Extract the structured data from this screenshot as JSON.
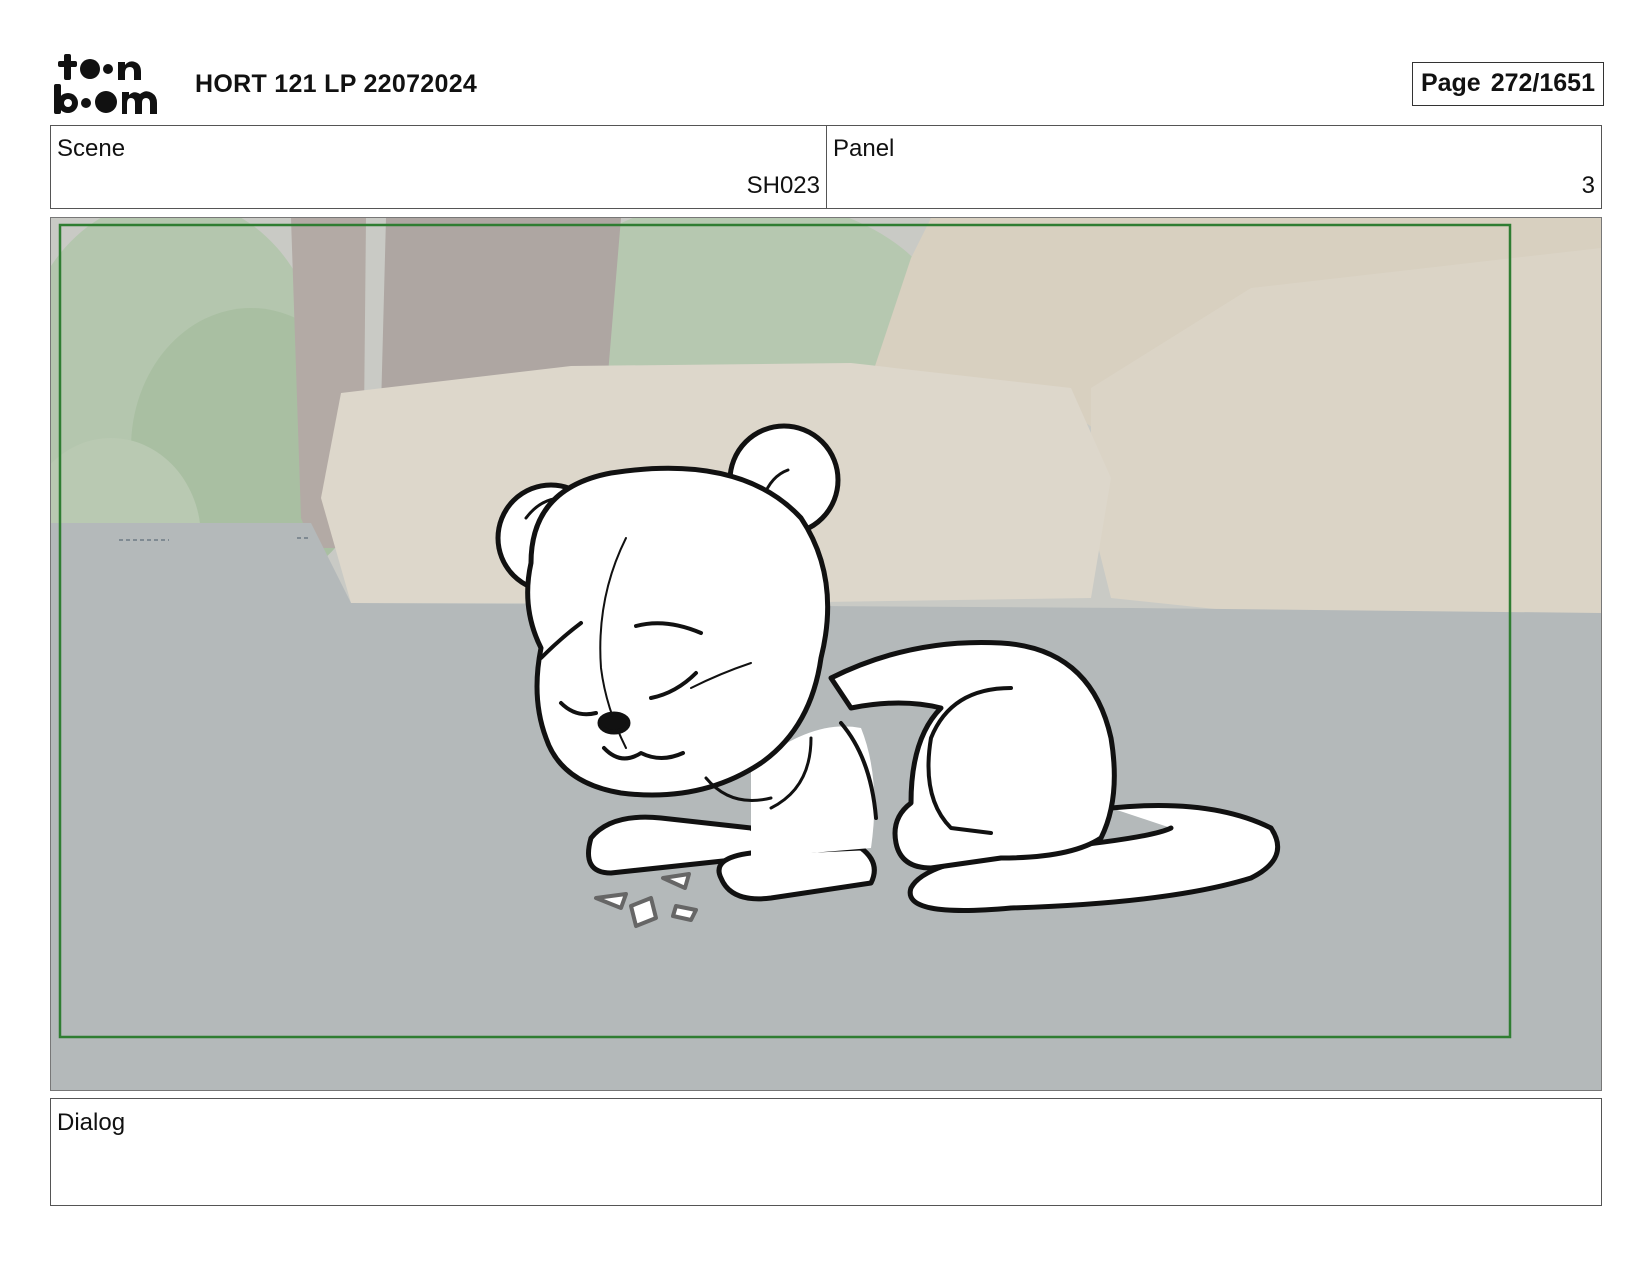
{
  "header": {
    "logo_text": "toon boom",
    "title": "HORT 121 LP 22072024",
    "page_label": "Page",
    "page_value": "272/1651"
  },
  "scene": {
    "label": "Scene",
    "value": "SH023"
  },
  "panel": {
    "label": "Panel",
    "value": "3"
  },
  "dialog": {
    "label": "Dialog",
    "value": ""
  },
  "colors": {
    "frame_border": "#2f7d32",
    "ground": "#b4b9ba",
    "rock": "#d8d0c0",
    "foliage": "#a9bfa2",
    "trunk": "#aaa39f"
  }
}
